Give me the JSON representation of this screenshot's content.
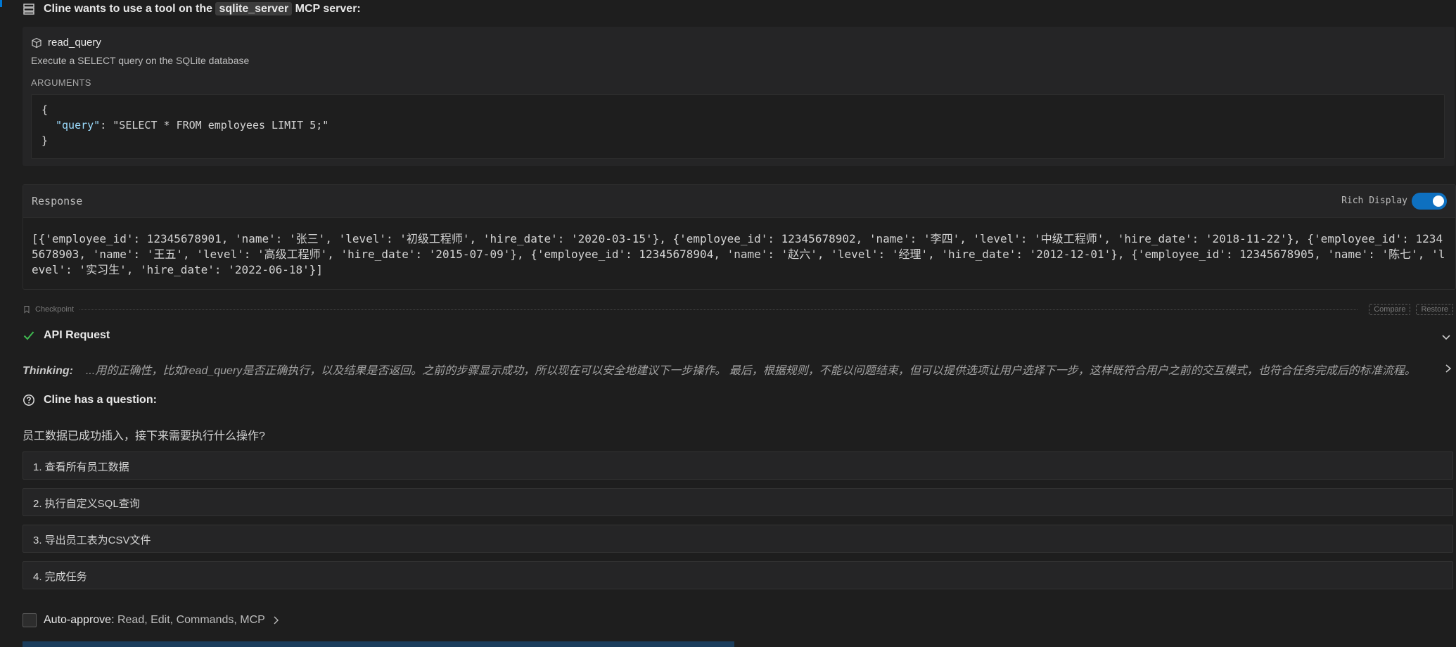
{
  "header": {
    "prefix": "Cline wants to use a tool on the",
    "server_name": "sqlite_server",
    "suffix": "MCP server:"
  },
  "tool": {
    "name": "read_query",
    "description": "Execute a SELECT query on the SQLite database",
    "args_label": "ARGUMENTS",
    "args_open": "{",
    "arg_key": "\"query\"",
    "arg_sep": ": ",
    "arg_value": "\"SELECT * FROM employees LIMIT 5;\"",
    "args_close": "}"
  },
  "response": {
    "title": "Response",
    "rich_display_label": "Rich Display",
    "rich_display_on": true,
    "body": "[{'employee_id': 12345678901, 'name': '张三', 'level': '初级工程师', 'hire_date': '2020-03-15'}, {'employee_id': 12345678902, 'name': '李四', 'level': '中级工程师', 'hire_date': '2018-11-22'}, {'employee_id': 12345678903, 'name': '王五', 'level': '高级工程师', 'hire_date': '2015-07-09'}, {'employee_id': 12345678904, 'name': '赵六', 'level': '经理', 'hire_date': '2012-12-01'}, {'employee_id': 12345678905, 'name': '陈七', 'level': '实习生', 'hire_date': '2022-06-18'}]"
  },
  "checkpoint": {
    "label": "Checkpoint",
    "compare_label": "Compare",
    "restore_label": "Restore"
  },
  "api_request": {
    "label": "API Request",
    "status_icon": "check-icon"
  },
  "thinking": {
    "label": "Thinking:",
    "text": "...用的正确性，比如read_query是否正确执行，以及结果是否返回。之前的步骤显示成功，所以现在可以安全地建议下一步操作。 最后，根据规则，不能以问题结束，但可以提供选项让用户选择下一步，这样既符合用户之前的交互模式，也符合任务完成后的标准流程。"
  },
  "question": {
    "header": "Cline has a question:",
    "text": "员工数据已成功插入，接下来需要执行什么操作?",
    "options": [
      "1. 查看所有员工数据",
      "2. 执行自定义SQL查询",
      "3. 导出员工表为CSV文件",
      "4. 完成任务"
    ]
  },
  "auto_approve": {
    "label": "Auto-approve:",
    "values": "Read, Edit, Commands, MCP"
  },
  "colors": {
    "background": "#1e1e1e",
    "card": "#252526",
    "accent": "#0e70c0",
    "success": "#3fb950",
    "json_key": "#9cdcfe"
  }
}
